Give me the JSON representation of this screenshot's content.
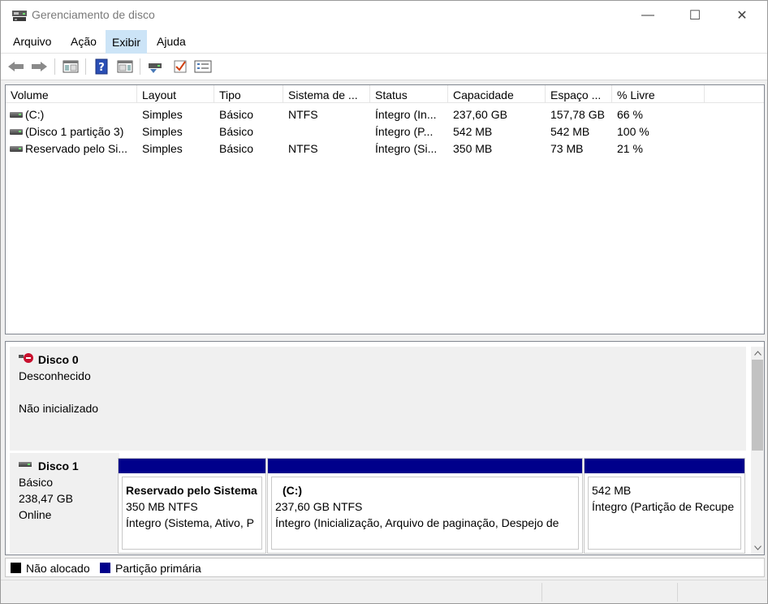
{
  "window": {
    "title": "Gerenciamento de disco",
    "minimize_glyph": "—",
    "maximize_glyph": "☐",
    "close_glyph": "✕"
  },
  "menu": [
    {
      "label": "Arquivo"
    },
    {
      "label": "Ação"
    },
    {
      "label": "Exibir",
      "active": true
    },
    {
      "label": "Ajuda"
    }
  ],
  "toolbar": {
    "icons": [
      "back-arrow-icon",
      "forward-arrow-icon",
      "show-hide-console-tree-icon",
      "help-icon",
      "properties-icon",
      "connect-disk-icon",
      "check-icon",
      "list-view-icon"
    ]
  },
  "volumes": {
    "columns": [
      "Volume",
      "Layout",
      "Tipo",
      "Sistema de ...",
      "Status",
      "Capacidade",
      "Espaço ...",
      "% Livre"
    ],
    "rows": [
      {
        "volume": " (C:)",
        "layout": "Simples",
        "tipo": "Básico",
        "fs": "NTFS",
        "status": "Íntegro (In...",
        "capacidade": "237,60 GB",
        "espaco": "157,78 GB",
        "livre": "66 %"
      },
      {
        "volume": "(Disco 1 partição 3)",
        "layout": "Simples",
        "tipo": "Básico",
        "fs": "",
        "status": "Íntegro (P...",
        "capacidade": "542 MB",
        "espaco": "542 MB",
        "livre": "100 %"
      },
      {
        "volume": "Reservado pelo Si...",
        "layout": "Simples",
        "tipo": "Básico",
        "fs": "NTFS",
        "status": "Íntegro (Si...",
        "capacidade": "350 MB",
        "espaco": "73 MB",
        "livre": "21 %"
      }
    ]
  },
  "disks": {
    "disk0": {
      "name": "Disco 0",
      "line1": "Desconhecido",
      "line2": "Não inicializado"
    },
    "disk1": {
      "name": "Disco 1",
      "type": "Básico",
      "size": "238,47 GB",
      "state": "Online"
    },
    "partitions": [
      {
        "name": "Reservado pelo Sistema",
        "size": "350 MB NTFS",
        "status": "Íntegro (Sistema, Ativo, P"
      },
      {
        "name": "(C:)",
        "size": "237,60 GB NTFS",
        "status": "Íntegro (Inicialização, Arquivo de paginação, Despejo de"
      },
      {
        "name": "",
        "size": "542 MB",
        "status": "Íntegro (Partição de Recupe"
      }
    ]
  },
  "legend": {
    "unallocated": {
      "label": "Não alocado",
      "color": "#000000"
    },
    "primary": {
      "label": "Partição primária",
      "color": "#00008b"
    }
  },
  "colors": {
    "menu_active": "#cce4f7",
    "partition_bar": "#00008b"
  }
}
